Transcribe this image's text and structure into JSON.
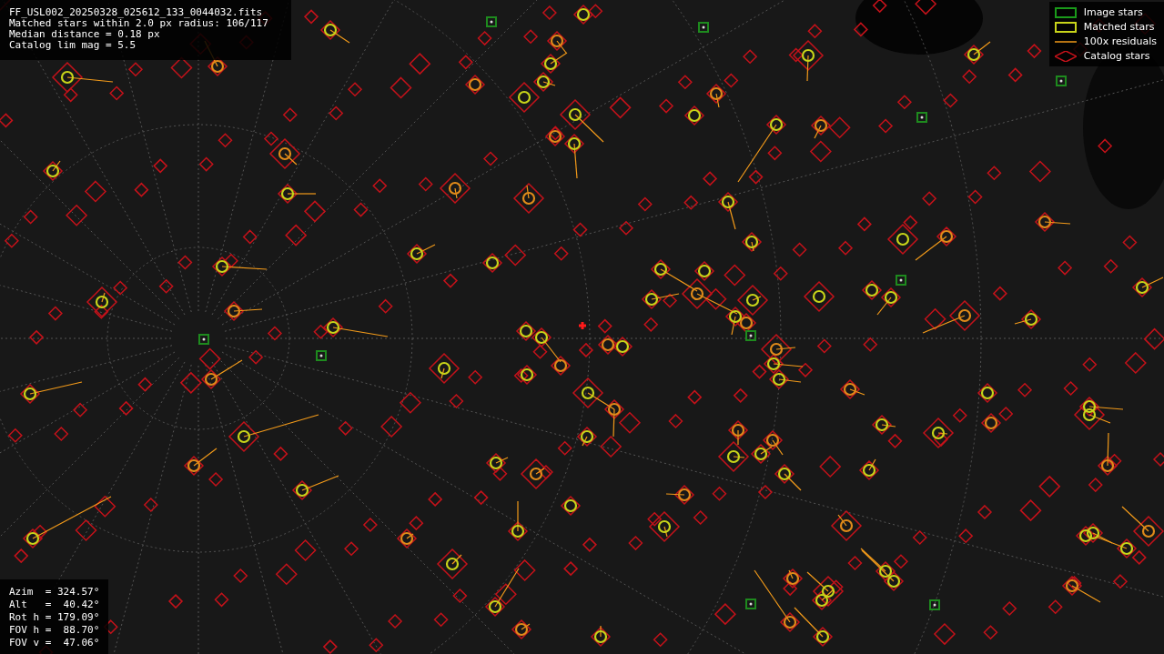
{
  "file_info": {
    "lines": [
      "FF_USL002_20250328_025612_133_0044032.fits",
      "Matched stars within 2.0 px radius: 106/117",
      "Median distance = 0.18 px",
      "Catalog lim mag = 5.5"
    ]
  },
  "legend": [
    {
      "kind": "image",
      "label": "Image stars"
    },
    {
      "kind": "matched",
      "label": "Matched stars"
    },
    {
      "kind": "residual",
      "label": "100x residuals"
    },
    {
      "kind": "catalog",
      "label": "Catalog stars"
    }
  ],
  "pointing": {
    "lines": [
      "Azim  = 324.57°",
      "Alt   =  40.42°",
      "Rot h = 179.09°",
      "FOV h =  88.70°",
      "FOV v =  47.06°"
    ]
  }
}
